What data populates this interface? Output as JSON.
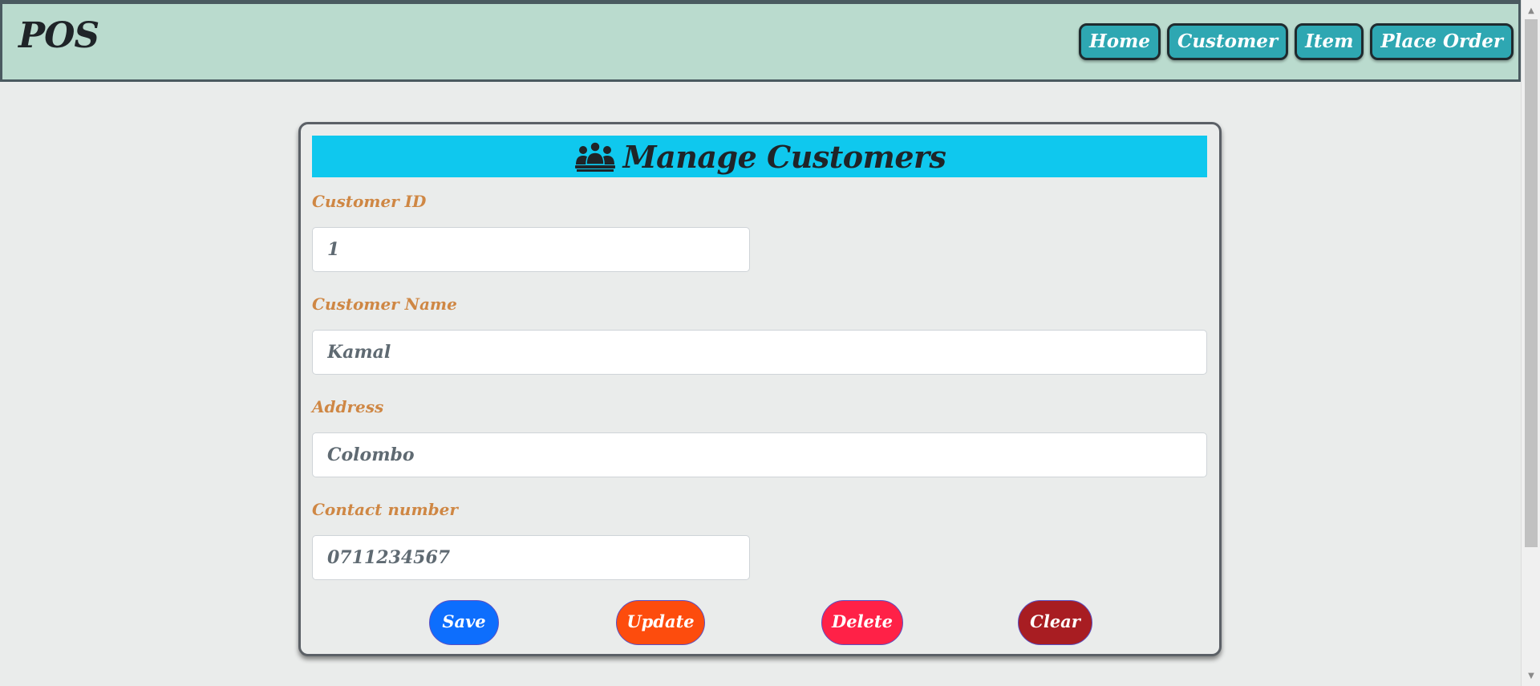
{
  "header": {
    "brand": "POS",
    "nav": [
      {
        "label": "Home"
      },
      {
        "label": "Customer"
      },
      {
        "label": "Item"
      },
      {
        "label": "Place Order"
      }
    ]
  },
  "card": {
    "title": "Manage Customers",
    "title_icon": "people-group-icon",
    "fields": {
      "customer_id": {
        "label": "Customer ID",
        "value": "1"
      },
      "customer_name": {
        "label": "Customer Name",
        "value": "Kamal"
      },
      "address": {
        "label": "Address",
        "value": "Colombo"
      },
      "contact": {
        "label": "Contact number",
        "value": "0711234567"
      }
    },
    "buttons": {
      "save": {
        "label": "Save",
        "color": "#0d6efd"
      },
      "update": {
        "label": "Update",
        "color": "#fd4c0d"
      },
      "delete": {
        "label": "Delete",
        "color": "#ff2147"
      },
      "clear": {
        "label": "Clear",
        "color": "#a81d22"
      }
    }
  },
  "colors": {
    "header_bg": "#badbce",
    "nav_button": "#2ea7b2",
    "title_bar": "#0fc8ee",
    "label_text": "#cf8744"
  }
}
